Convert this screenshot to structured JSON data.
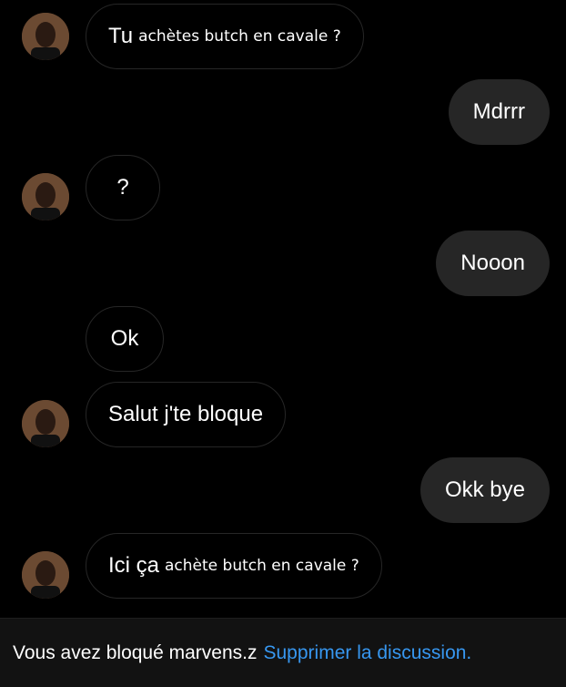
{
  "contact": {
    "username": "marvens.z"
  },
  "messages": [
    {
      "side": "in",
      "text": "Tu",
      "overlay": "achètes butch en cavale ?"
    },
    {
      "side": "out",
      "text": "Mdrrr"
    },
    {
      "side": "in",
      "text": "?"
    },
    {
      "side": "out",
      "text": "Nooon"
    },
    {
      "side": "in",
      "text": "Ok"
    },
    {
      "side": "in",
      "text": "Salut j'te bloque"
    },
    {
      "side": "out",
      "text": "Okk bye"
    },
    {
      "side": "in",
      "text": "Ici ça",
      "overlay": "achète butch en cavale ?"
    }
  ],
  "footer": {
    "notice": "Vous avez bloqué marvens.z",
    "action": "Supprimer la discussion."
  },
  "colors": {
    "background": "#000000",
    "outgoing_bubble": "#262626",
    "incoming_border": "#262626",
    "link": "#3797f0",
    "footer_bg": "#121212"
  },
  "icons": {
    "avatar": "profile-photo"
  }
}
